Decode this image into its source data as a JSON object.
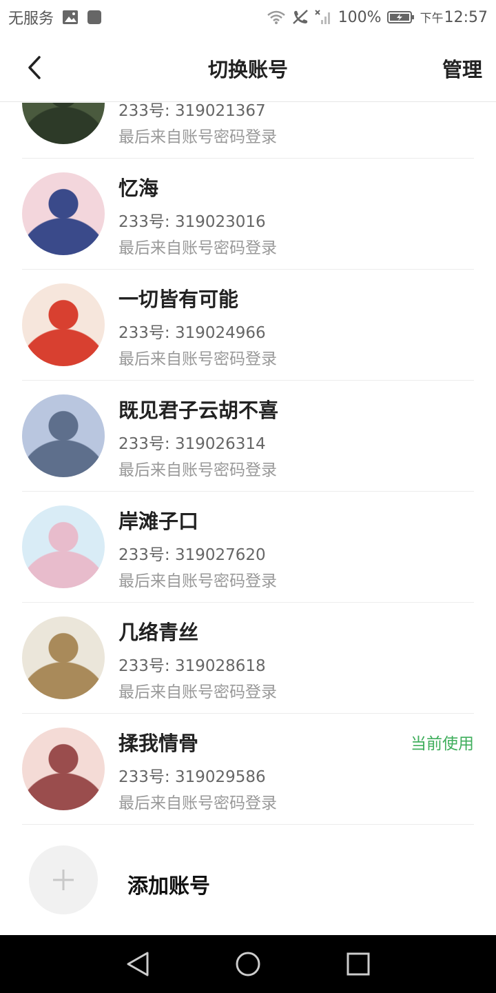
{
  "status_bar": {
    "carrier": "无服务",
    "battery": "100%",
    "time_prefix": "下午",
    "time": "12:57",
    "icons": [
      "image-icon",
      "app-icon",
      "wifi-icon",
      "no-call-icon",
      "no-signal-icon",
      "battery-charging-icon"
    ]
  },
  "header": {
    "back_icon": "chevron-left-icon",
    "title": "切换账号",
    "manage_label": "管理"
  },
  "accounts": [
    {
      "name": "",
      "id": "233号: 319021367",
      "login": "最后来自账号密码登录",
      "current": "",
      "avatar_colors": [
        "#4a5a3e",
        "#2d3a28"
      ]
    },
    {
      "name": "忆海",
      "id": "233号: 319023016",
      "login": "最后来自账号密码登录",
      "current": "",
      "avatar_colors": [
        "#f3d6dc",
        "#3a4a8a"
      ]
    },
    {
      "name": "一切皆有可能",
      "id": "233号: 319024966",
      "login": "最后来自账号密码登录",
      "current": "",
      "avatar_colors": [
        "#f6e6dc",
        "#d84030"
      ]
    },
    {
      "name": "既见君子云胡不喜",
      "id": "233号: 319026314",
      "login": "最后来自账号密码登录",
      "current": "",
      "avatar_colors": [
        "#b9c6df",
        "#5e6f8c"
      ]
    },
    {
      "name": "岸滩子口",
      "id": "233号: 319027620",
      "login": "最后来自账号密码登录",
      "current": "",
      "avatar_colors": [
        "#d9ecf6",
        "#e8bccc"
      ]
    },
    {
      "name": "几络青丝",
      "id": "233号: 319028618",
      "login": "最后来自账号密码登录",
      "current": "",
      "avatar_colors": [
        "#ebe6da",
        "#a98a5a"
      ]
    },
    {
      "name": "揉我情骨",
      "id": "233号: 319029586",
      "login": "最后来自账号密码登录",
      "current": "当前使用",
      "avatar_colors": [
        "#f4dbd6",
        "#9a4d4d"
      ]
    }
  ],
  "add_account": {
    "label": "添加账号",
    "icon": "plus-icon"
  },
  "nav_bar": {
    "icons": [
      "back-triangle-icon",
      "home-circle-icon",
      "recents-square-icon"
    ]
  },
  "colors": {
    "accent_green": "#3fae5c",
    "text_primary": "#222222",
    "text_secondary": "#666666",
    "text_muted": "#999999",
    "divider": "#ececec"
  }
}
